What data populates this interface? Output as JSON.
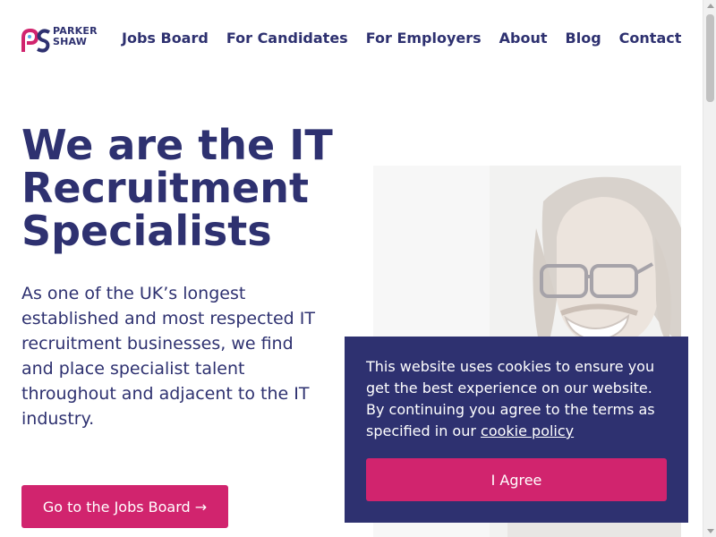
{
  "brand": {
    "logo_line1": "PARKER",
    "logo_line2": "SHAW",
    "primary_color": "#2e3170",
    "accent_color": "#d1246e"
  },
  "nav": {
    "items": [
      {
        "label": "Jobs Board"
      },
      {
        "label": "For Candidates"
      },
      {
        "label": "For Employers"
      },
      {
        "label": "About"
      },
      {
        "label": "Blog"
      },
      {
        "label": "Contact"
      }
    ]
  },
  "hero": {
    "title": "We are the IT Recruitment Specialists",
    "description": "As one of the UK’s longest established and most respected IT recruitment businesses, we find and place specialist talent throughout and adjacent to the IT industry.",
    "cta_label": "Go to the Jobs Board →",
    "image_icon": "smiling-man-photo"
  },
  "cookie": {
    "text": "This website uses cookies to ensure you get the best experience on our website. By continuing you agree to the terms as specified in our ",
    "link_label": "cookie policy",
    "button_label": "I Agree"
  }
}
